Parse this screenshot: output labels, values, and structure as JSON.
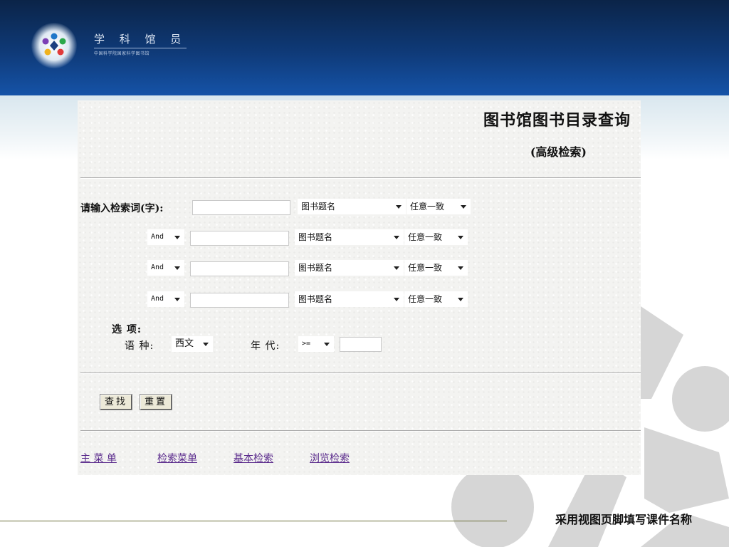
{
  "slide": {
    "logo_title": "学 科 馆 员",
    "logo_subtitle": "中国科学院国家科学图书馆",
    "footer_text": "采用视图页脚填写课件名称"
  },
  "page": {
    "title": "图书馆图书目录查询",
    "subtitle": "(高级检索)",
    "prompt_label": "请输入检索词(字):",
    "rows": [
      {
        "operator": "",
        "term": "",
        "field": "图书题名",
        "match": "任意一致"
      },
      {
        "operator": "And",
        "term": "",
        "field": "图书题名",
        "match": "任意一致"
      },
      {
        "operator": "And",
        "term": "",
        "field": "图书题名",
        "match": "任意一致"
      },
      {
        "operator": "And",
        "term": "",
        "field": "图书题名",
        "match": "任意一致"
      }
    ],
    "options": {
      "heading": "选  项:",
      "language_label": "语  种:",
      "language_value": "西文",
      "year_label": "年  代:",
      "year_operator": ">=",
      "year_value": ""
    },
    "buttons": {
      "search": "查找",
      "reset": "重置"
    },
    "nav": {
      "main_menu": "主 菜 单",
      "search_menu": "检索菜单",
      "basic_search": "基本检索",
      "browse_search": "浏览检索"
    }
  }
}
